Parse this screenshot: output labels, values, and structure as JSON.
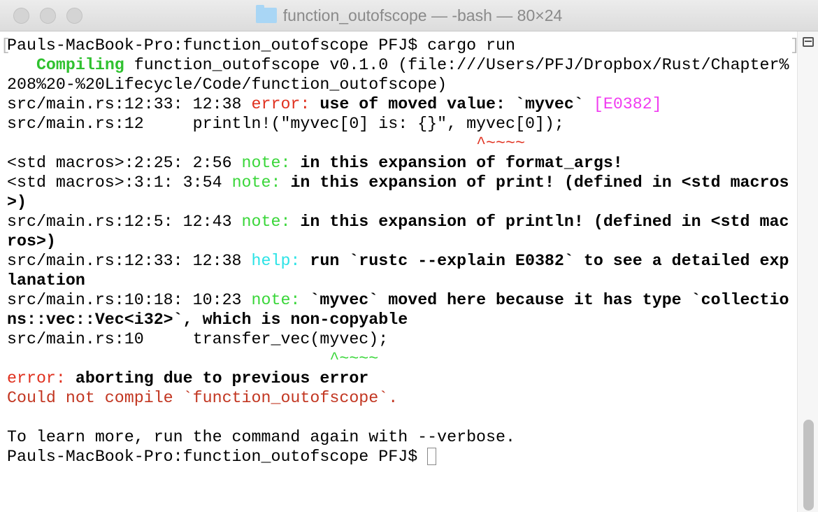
{
  "window": {
    "title": "function_outofscope — -bash — 80×24"
  },
  "colors": {
    "green": "#2fc12f",
    "red": "#e0301e",
    "magenta": "#f03cf0",
    "cyan": "#2ce3e6"
  },
  "terminal": {
    "lines": [
      [
        {
          "t": "Pauls-MacBook-Pro:function_outofscope PFJ$ cargo run",
          "s": ""
        }
      ],
      [
        {
          "t": "   ",
          "s": ""
        },
        {
          "t": "Compiling",
          "s": "b green"
        },
        {
          "t": " function_outofscope v0.1.0 (file:///Users/PFJ/Dropbox/Rust/Chapter%",
          "s": ""
        }
      ],
      [
        {
          "t": "208%20-%20Lifecycle/Code/function_outofscope)",
          "s": ""
        }
      ],
      [
        {
          "t": "src/main.rs:12:33: 12:38 ",
          "s": ""
        },
        {
          "t": "error: ",
          "s": "red"
        },
        {
          "t": "use of moved value: `myvec`",
          "s": "b"
        },
        {
          "t": " ",
          "s": ""
        },
        {
          "t": "[E0382]",
          "s": "magenta"
        }
      ],
      [
        {
          "t": "src/main.rs:12     println!(\"myvec[0] is: {}\", myvec[0]);",
          "s": ""
        }
      ],
      [
        {
          "t": "                                                ",
          "s": ""
        },
        {
          "t": "^~~~~",
          "s": "red"
        }
      ],
      [
        {
          "t": "<std macros>:2:25: 2:56 ",
          "s": ""
        },
        {
          "t": "note: ",
          "s": "lgreen"
        },
        {
          "t": "in this expansion of format_args!",
          "s": "b"
        }
      ],
      [
        {
          "t": "<std macros>:3:1: 3:54 ",
          "s": ""
        },
        {
          "t": "note: ",
          "s": "lgreen"
        },
        {
          "t": "in this expansion of print! (defined in <std macros",
          "s": "b"
        }
      ],
      [
        {
          "t": ">)",
          "s": "b"
        }
      ],
      [
        {
          "t": "src/main.rs:12:5: 12:43 ",
          "s": ""
        },
        {
          "t": "note: ",
          "s": "lgreen"
        },
        {
          "t": "in this expansion of println! (defined in <std mac",
          "s": "b"
        }
      ],
      [
        {
          "t": "ros>)",
          "s": "b"
        }
      ],
      [
        {
          "t": "src/main.rs:12:33: 12:38 ",
          "s": ""
        },
        {
          "t": "help: ",
          "s": "cyan"
        },
        {
          "t": "run `rustc --explain E0382` to see a detailed exp",
          "s": "b"
        }
      ],
      [
        {
          "t": "lanation",
          "s": "b"
        }
      ],
      [
        {
          "t": "src/main.rs:10:18: 10:23 ",
          "s": ""
        },
        {
          "t": "note: ",
          "s": "lgreen"
        },
        {
          "t": "`myvec` moved here because it has type `collectio",
          "s": "b"
        }
      ],
      [
        {
          "t": "ns::vec::Vec<i32>`, which is non-copyable",
          "s": "b"
        }
      ],
      [
        {
          "t": "src/main.rs:10     transfer_vec(myvec);",
          "s": ""
        }
      ],
      [
        {
          "t": "                                 ",
          "s": ""
        },
        {
          "t": "^~~~~",
          "s": "lgreen"
        }
      ],
      [
        {
          "t": "error: ",
          "s": "red"
        },
        {
          "t": "aborting due to previous error",
          "s": "b"
        }
      ],
      [
        {
          "t": "Could not compile `function_outofscope`.",
          "s": "darkred"
        }
      ],
      [
        {
          "t": "",
          "s": ""
        }
      ],
      [
        {
          "t": "To learn more, run the command again with --verbose.",
          "s": ""
        }
      ],
      [
        {
          "t": "Pauls-MacBook-Pro:function_outofscope PFJ$ ",
          "s": ""
        }
      ]
    ]
  }
}
